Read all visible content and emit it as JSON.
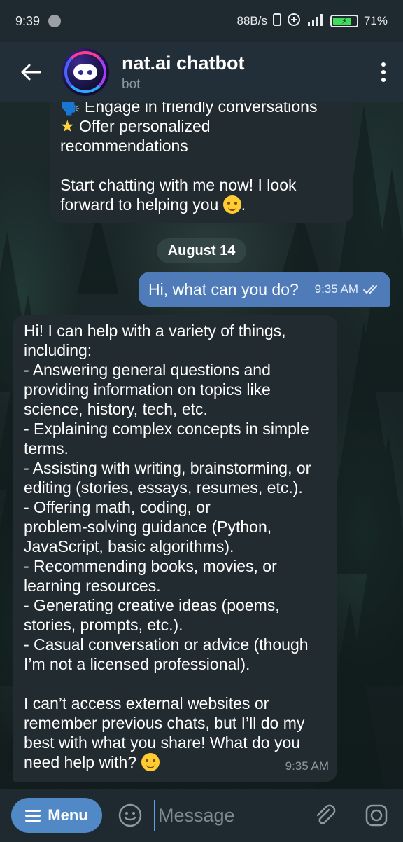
{
  "status_bar": {
    "time": "9:39",
    "net_speed": "88B/s",
    "signal": "4G",
    "battery": "71%",
    "battery_level": 0.71
  },
  "header": {
    "title": "nat.ai chatbot",
    "subtitle": "bot"
  },
  "messages": {
    "intro_lines": [
      "Engage in friendly conversations",
      "Offer personalized",
      "recommendations",
      "",
      "Start chatting with me now! I look",
      "forward to helping you"
    ],
    "date_separator": "August 14",
    "user_message": {
      "text": "Hi, what can you do?",
      "time": "9:35 AM"
    },
    "bot_reply": {
      "lines": [
        "Hi! I can help with a variety of things,",
        "including:",
        "- Answering general questions and",
        "providing information on topics like",
        "science, history, tech, etc.",
        "- Explaining complex concepts in simple",
        "terms.",
        "- Assisting with writing, brainstorming, or",
        "editing (stories, essays, resumes, etc.).",
        "- Offering math, coding, or",
        "problem-solving guidance (Python,",
        "JavaScript, basic algorithms).",
        "- Recommending books, movies, or",
        "learning resources.",
        "- Generating creative ideas (poems,",
        "stories, prompts, etc.).",
        "- Casual conversation or advice (though",
        "I’m not a licensed professional).",
        "",
        "I can’t access external websites or",
        "remember previous chats, but I’ll do my",
        "best with what you share! What do you",
        "need help with?"
      ],
      "time": "9:35 AM"
    }
  },
  "input_bar": {
    "menu_label": "Menu",
    "placeholder": "Message"
  },
  "colors": {
    "accent": "#5189c6",
    "outgoing_bubble": "#4f7cb8",
    "incoming_bubble": "#222b2f",
    "header_bg": "#232f38"
  },
  "icons": {
    "back": "arrow-left-icon",
    "more": "more-vertical-icon",
    "emoji": "smiley-icon",
    "attach": "paperclip-icon",
    "camera": "camera-icon",
    "read": "double-check-icon"
  }
}
